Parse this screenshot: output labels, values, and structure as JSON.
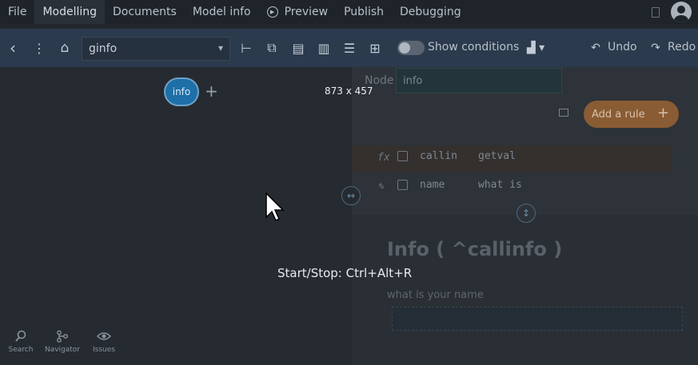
{
  "menubar": {
    "items": [
      {
        "label": "File"
      },
      {
        "label": "Modelling"
      },
      {
        "label": "Documents"
      },
      {
        "label": "Model info"
      },
      {
        "label": "Preview"
      },
      {
        "label": "Publish"
      },
      {
        "label": "Debugging"
      }
    ]
  },
  "toolbar": {
    "node_select": "ginfo",
    "show_conditions": "Show conditions",
    "undo": "Undo",
    "redo": "Redo"
  },
  "canvas": {
    "node_label": "info",
    "nav": [
      {
        "label": "Search"
      },
      {
        "label": "Navigator"
      },
      {
        "label": "Issues"
      }
    ]
  },
  "panel": {
    "node_label": "Node",
    "node_value": "info",
    "add_rule": "Add a rule",
    "rows": [
      {
        "col1": "callin",
        "col2": "getval"
      },
      {
        "col1": "name",
        "col2": "what is"
      }
    ],
    "info_title": "Info ( ^callinfo )",
    "info_sub": "what is your name"
  },
  "overlay": {
    "dimensions": "873 x 457",
    "hint": "Start/Stop: Ctrl+Alt+R"
  }
}
